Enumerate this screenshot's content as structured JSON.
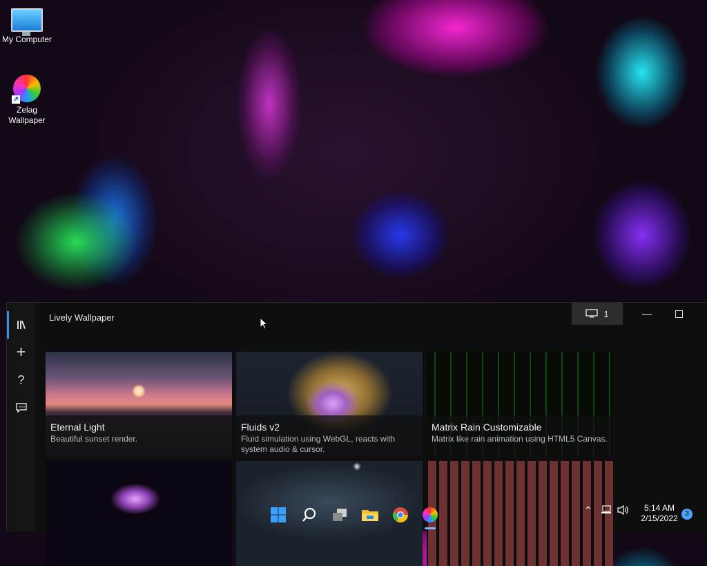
{
  "desktop": {
    "icons": [
      {
        "label": "My Computer"
      },
      {
        "label_line1": "Zelag",
        "label_line2": "Wallpaper"
      }
    ]
  },
  "app": {
    "title": "Lively Wallpaper",
    "monitor_count": "1",
    "sidebar": [
      {
        "icon": "library-icon"
      },
      {
        "icon": "add-icon",
        "glyph": "+"
      },
      {
        "icon": "help-icon",
        "glyph": "?"
      },
      {
        "icon": "feedback-icon"
      }
    ],
    "wallpapers": [
      {
        "title": "Eternal Light",
        "desc": "Beautiful sunset render."
      },
      {
        "title": "Fluids v2",
        "desc": "Fluid simulation using WebGL, reacts with system audio & cursor.",
        "selected": true
      },
      {
        "title": "Matrix Rain Customizable",
        "desc": "Matrix like rain animation using HTML5 Canvas."
      }
    ]
  },
  "taskbar": {
    "clock_time": "5:14 AM",
    "clock_date": "2/15/2022",
    "notification_count": "3"
  },
  "colors": {
    "accent": "#3a8fe3",
    "app_bg": "#0e0e0e",
    "sidebar_bg": "#141414"
  }
}
